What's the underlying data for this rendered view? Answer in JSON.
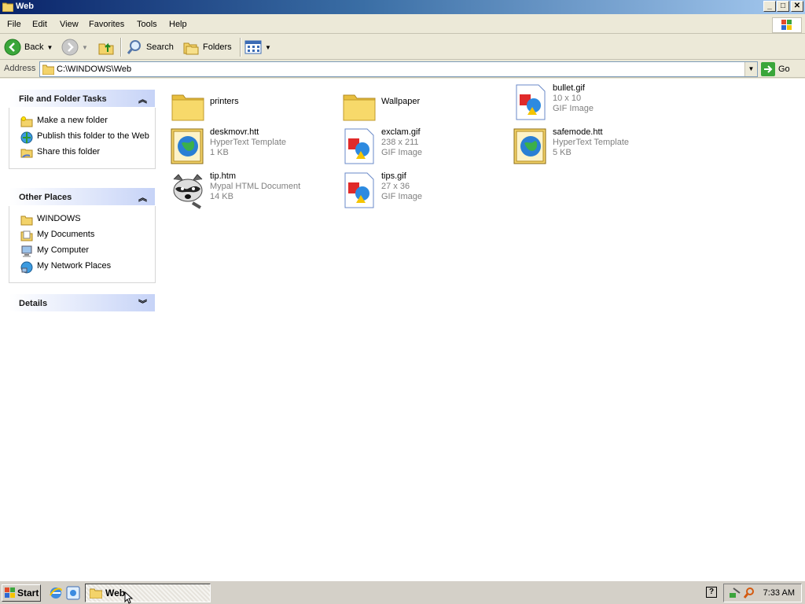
{
  "window": {
    "title": "Web",
    "minimize": "_",
    "maximize": "□",
    "close": "✕"
  },
  "menu": [
    "File",
    "Edit",
    "View",
    "Favorites",
    "Tools",
    "Help"
  ],
  "toolbar": {
    "back": "Back",
    "search": "Search",
    "folders": "Folders"
  },
  "address": {
    "label": "Address",
    "value": "C:\\WINDOWS\\Web",
    "go": "Go"
  },
  "tasks": {
    "file_folder": {
      "title": "File and Folder Tasks",
      "items": [
        "Make a new folder",
        "Publish this folder to the Web",
        "Share this folder"
      ]
    },
    "other_places": {
      "title": "Other Places",
      "items": [
        "WINDOWS",
        "My Documents",
        "My Computer",
        "My Network Places"
      ]
    },
    "details": {
      "title": "Details"
    }
  },
  "files": [
    {
      "name": "printers",
      "type": "folder",
      "line1": "",
      "line2": ""
    },
    {
      "name": "Wallpaper",
      "type": "folder",
      "line1": "",
      "line2": ""
    },
    {
      "name": "bullet.gif",
      "type": "gif",
      "line1": "10 x 10",
      "line2": "GIF Image"
    },
    {
      "name": "deskmovr.htt",
      "type": "htt",
      "line1": "HyperText Template",
      "line2": "1 KB"
    },
    {
      "name": "exclam.gif",
      "type": "gif",
      "line1": "238 x 211",
      "line2": "GIF Image"
    },
    {
      "name": "safemode.htt",
      "type": "htt",
      "line1": "HyperText Template",
      "line2": "5 KB"
    },
    {
      "name": "tip.htm",
      "type": "htm",
      "line1": "Mypal HTML Document",
      "line2": "14 KB"
    },
    {
      "name": "tips.gif",
      "type": "gif",
      "line1": "27 x 36",
      "line2": "GIF Image"
    }
  ],
  "taskbar": {
    "start": "Start",
    "task": "Web",
    "time": "7:33 AM",
    "help_icon": "?"
  }
}
